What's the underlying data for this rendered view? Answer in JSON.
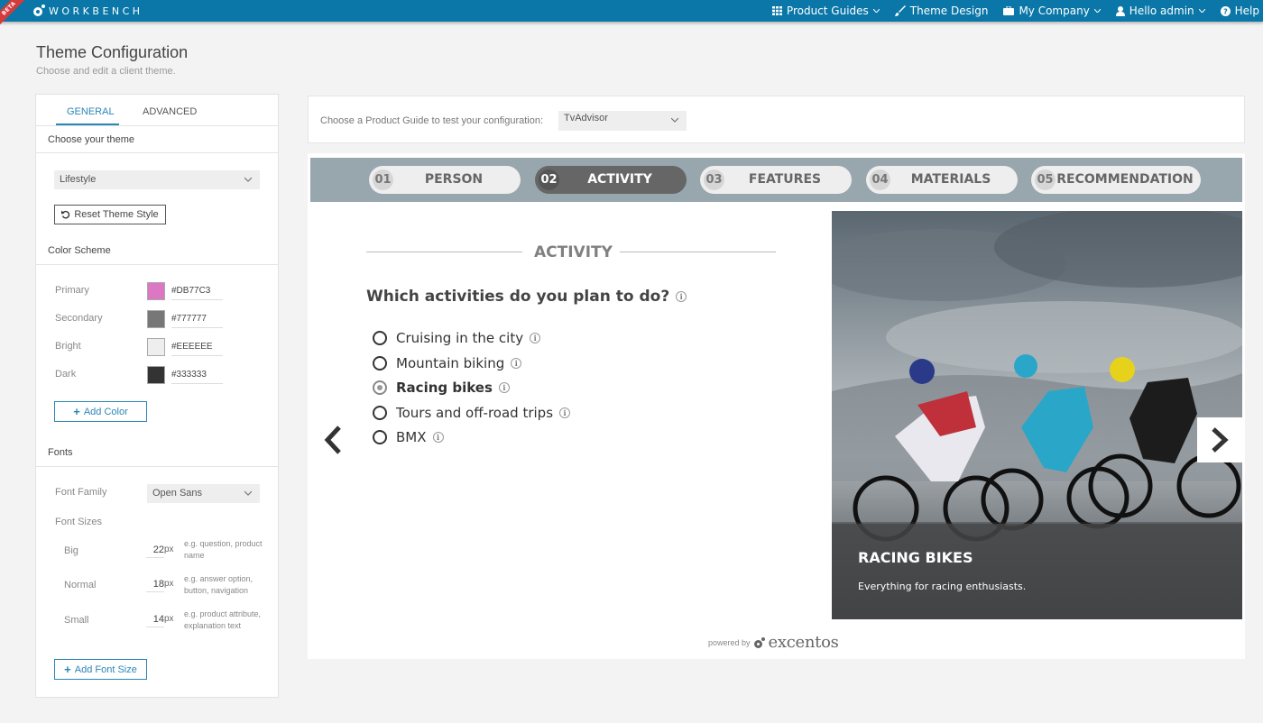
{
  "topbar": {
    "beta": "BETA",
    "logo_text": "WORKBENCH",
    "nav": {
      "product_guides": "Product Guides",
      "theme_design": "Theme Design",
      "my_company": "My Company",
      "hello_admin": "Hello admin",
      "help": "Help"
    }
  },
  "page": {
    "title": "Theme Configuration",
    "subtitle": "Choose and edit a client theme."
  },
  "left_panel": {
    "tabs": {
      "general": "GENERAL",
      "advanced": "ADVANCED"
    },
    "choose_theme_label": "Choose your theme",
    "theme_select": "Lifestyle",
    "reset_button": "Reset Theme Style",
    "color_scheme_label": "Color Scheme",
    "colors": [
      {
        "label": "Primary",
        "hex": "#DB77C3",
        "color": "#DB77C3"
      },
      {
        "label": "Secondary",
        "hex": "#777777",
        "color": "#777777"
      },
      {
        "label": "Bright",
        "hex": "#EEEEEE",
        "color": "#EEEEEE"
      },
      {
        "label": "Dark",
        "hex": "#333333",
        "color": "#333333"
      }
    ],
    "add_color_button": "Add Color",
    "fonts_label": "Fonts",
    "font_family_label": "Font Family",
    "font_family_select": "Open Sans",
    "font_sizes_label": "Font Sizes",
    "font_sizes": [
      {
        "label": "Big",
        "value": "22",
        "unit": "px",
        "hint": "e.g. question, product name"
      },
      {
        "label": "Normal",
        "value": "18",
        "unit": "px",
        "hint": "e.g. answer option, button, navigation"
      },
      {
        "label": "Small",
        "value": "14",
        "unit": "px",
        "hint": "e.g. product attribute, explanation text"
      }
    ],
    "add_font_size_button": "Add Font Size"
  },
  "guide_bar": {
    "label": "Choose a Product Guide to test your configuration:",
    "select": "TvAdvisor"
  },
  "preview": {
    "steps": [
      {
        "num": "01",
        "label": "PERSON"
      },
      {
        "num": "02",
        "label": "ACTIVITY"
      },
      {
        "num": "03",
        "label": "FEATURES"
      },
      {
        "num": "04",
        "label": "MATERIALS"
      },
      {
        "num": "05",
        "label": "RECOMMENDATION"
      }
    ],
    "section_heading": "ACTIVITY",
    "question": "Which activities do you plan to do?",
    "options": [
      {
        "label": "Cruising in the city",
        "selected": false
      },
      {
        "label": "Mountain biking",
        "selected": false
      },
      {
        "label": "Racing bikes",
        "selected": true
      },
      {
        "label": "Tours and off-road trips",
        "selected": false
      },
      {
        "label": "BMX",
        "selected": false
      }
    ],
    "info_glyph": "i",
    "caption_title": "RACING BIKES",
    "caption_sub": "Everything for racing enthusiasts.",
    "powered_by": "powered by",
    "brand": "excentos"
  }
}
